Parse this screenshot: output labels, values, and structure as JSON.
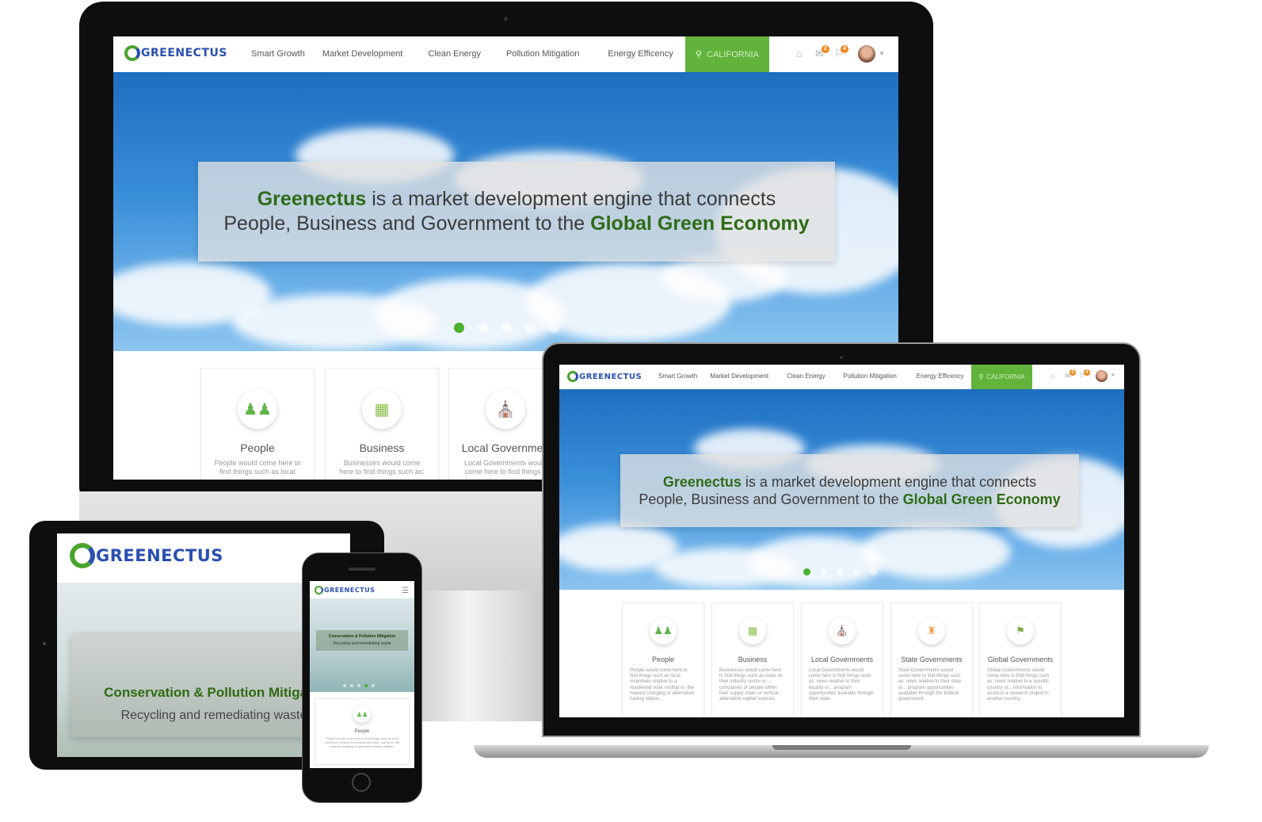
{
  "brand": {
    "logo_text": "GREENECTUS",
    "logo_initial": "G"
  },
  "nav": {
    "items": [
      "Smart Growth",
      "Market Development",
      "Clean Energy",
      "Pollution Mitigation",
      "Energy Efficency"
    ],
    "location_label": "CALIFORNIA",
    "notification_count_1": "2",
    "notification_count_2": "4"
  },
  "hero": {
    "brand_word": "Greenectus",
    "line1_rest": " is a market development engine that connects",
    "line2_start": "People, Business and Government to the ",
    "line2_bold": "Global Green Economy"
  },
  "cards": [
    {
      "title": "People",
      "desc": "People would come here to find things such as local incentives relative to a residential solar rooftop or, the nearest charging or alternative fueling station.",
      "icon": "people-icon",
      "color": "#5fb547"
    },
    {
      "title": "Business",
      "desc": "Businesses would come here to find things such as news on their industry sector or... companies or people within their supply chain or vertical - alternative capital sources.",
      "icon": "buildings-icon",
      "color": "#8bbf4a"
    },
    {
      "title": "Local Governments",
      "desc": "Local Governments would come here to find things such as: news relative to their locality or... program opportunities available through their state.",
      "icon": "bank-icon",
      "color": "#e0504a"
    },
    {
      "title": "State Governments",
      "desc": "State Governments would come here to find things such as: news relative to their state or... program opportunities available through the federal government.",
      "icon": "capitol-icon",
      "color": "#f0a050"
    },
    {
      "title": "Global Governments",
      "desc": "Global Governments would come here to find things such as: news relative to a specific country or... information to assist in a research project in another country.",
      "icon": "globe-podium-icon",
      "color": "#7fa84a"
    }
  ],
  "desktop_cards_text": {
    "people_desc": "People would come here to find things such as local",
    "business_desc": "Businesses would come here to find things such as:",
    "local_title": "Local Governmen",
    "local_desc": "Local Governments would come here to find things s"
  },
  "tablet": {
    "logo_text": "GREENECTUS",
    "slide_title": "Conservation & Pollution Mitigatio",
    "slide_subtitle": "Recycling and remediating waste"
  },
  "phone": {
    "logo_text": "GREENECTUS",
    "slide_title": "Conservation & Pollution Mitigation",
    "slide_subtitle": "Recycling and remediating waste",
    "card_title": "People",
    "card_desc": "People would come here to find things such as local incentives relative to a residential solar rooftop or, the nearest charging or alternative fueling station."
  },
  "colors": {
    "brand_green": "#62b33b",
    "brand_blue": "#2a4fb0",
    "device_black": "#0e0e0e"
  }
}
